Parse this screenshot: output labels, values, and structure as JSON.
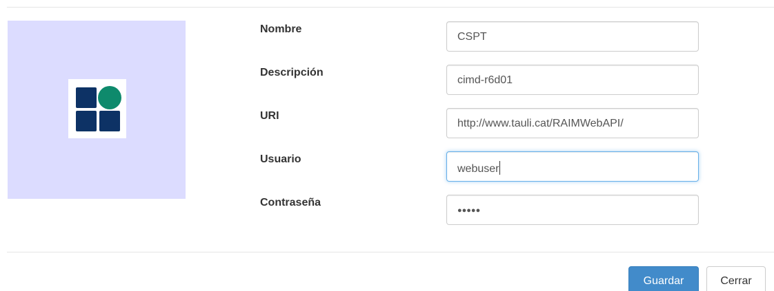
{
  "form": {
    "fields": [
      {
        "label": "Nombre",
        "value": "CSPT"
      },
      {
        "label": "Descripción",
        "value": "cimd-r6d01"
      },
      {
        "label": "URI",
        "value": "http://www.tauli.cat/RAIMWebAPI/"
      },
      {
        "label": "Usuario",
        "value": "webuser"
      },
      {
        "label": "Contraseña",
        "value": "●●●●●"
      }
    ]
  },
  "buttons": {
    "save_label": "Guardar",
    "close_label": "Cerrar"
  },
  "colors": {
    "logo_panel_bg": "#dcdcff",
    "logo_navy": "#0d3265",
    "logo_green": "#0e8a6c",
    "primary": "#428bca",
    "focus_border": "#66afe9"
  },
  "icons": {
    "logo": "blocks-logo-icon"
  }
}
